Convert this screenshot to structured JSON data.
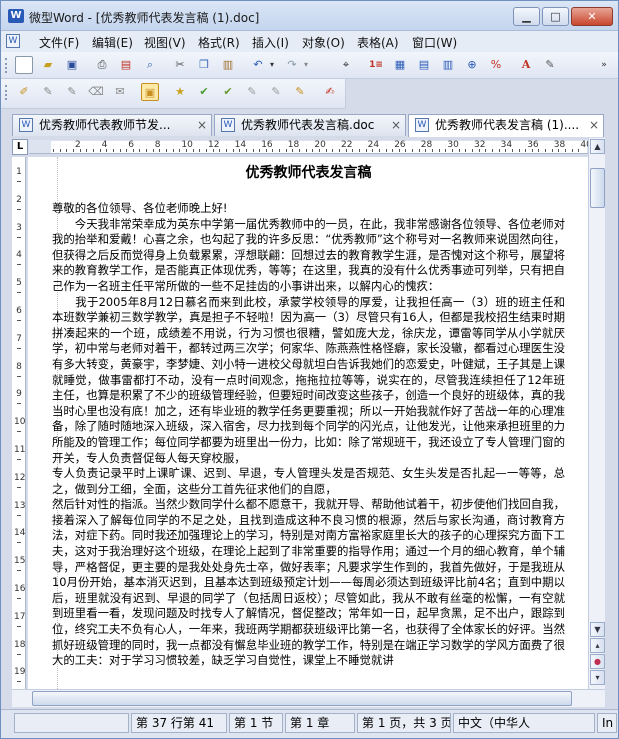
{
  "window": {
    "title": "微型Word - [优秀教师代表发言稿 (1).doc]",
    "app_icon": "W"
  },
  "menu": [
    "文件(F)",
    "编辑(E)",
    "视图(V)",
    "格式(R)",
    "插入(I)",
    "对象(O)",
    "表格(A)",
    "窗口(W)"
  ],
  "tabs": [
    "优秀教师代表教师节发...",
    "优秀教师代表发言稿.doc",
    "优秀教师代表发言稿 (1)...."
  ],
  "ruler_labels": [
    "2",
    "4",
    "6",
    "8",
    "10",
    "12",
    "14",
    "16",
    "18",
    "20",
    "22",
    "24",
    "26",
    "28",
    "30",
    "32",
    "34",
    "36",
    "38",
    "40"
  ],
  "vruler_labels": [
    "1",
    "2",
    "3",
    "4",
    "5",
    "6",
    "7",
    "8",
    "9",
    "10",
    "11",
    "12",
    "13",
    "14",
    "15",
    "16",
    "17",
    "18",
    "19"
  ],
  "document": {
    "title": "优秀教师代表发言稿",
    "paragraphs": [
      "尊敬的各位领导、各位老师晚上好!",
      "　　今天我非常荣幸成为英东中学第一届优秀教师中的一员，在此，我非常感谢各位领导、各位老师对我的抬举和爱戴！心喜之余，也勾起了我的许多反思：“优秀教师”这个称号对一名教师来说固然向往，但获得之后反而觉得身上负载累累，浮想联翩：回想过去的教育教学生涯，是否愧对这个称号，展望将来的教育教学工作，是否能真正体现优秀，等等；在这里，我真的没有什么优秀事迹可列举，只有把自己作为一名班主任平常所做的一些不足挂齿的小事讲出来，以解内心的愧疚：",
      "　　我于2005年8月12日慕名而来到此校，承蒙学校领导的厚爱，让我担任高一（3）班的班主任和本班数学兼初三数学教学，真是担子不轻啦！因为高一（3）尽管只有16人，但都是我校招生结束时期拼凑起来的一个班，成绩差不用说，行为习惯也很糟，譬如庞大龙，徐庆龙，谭雷等同学从小学就厌学，初中常与老师对着干，都转过两三次学；何家华、陈燕燕性格怪癖，家长没辙，都看过心理医生没有多大转变，黄豪宇，李梦婕、刘小特一进校父母就坦白告诉我她们的恋爱史，叶健斌，王子其是上课就睡觉，做事雷都打不动，没有一点时间观念，拖拖拉拉等等，说实在的，尽管我连续担任了12年班主任，也算是积累了不少的班级管理经验，但要短时间改变这些孩子，创造一个良好的班级体，真的我当时心里也没有底！加之，还有毕业班的教学任务更要重视；所以一开始我就作好了苦战一年的心理准备，除了随时随地深入班级，深入宿舍，尽力找到每个同学的闪光点，让他发光，让他来承担班里的力所能及的管理工作；每位同学都要为班里出一份力，比如：除了常规班干，我还设立了专人管理门窗的开关，专人负责督促每人每天穿校服，",
      "专人负责记录平时上课旷课、迟到、早退，专人管理头发是否规范、女生头发是否扎起—一等等，总之，做到分工细，全面，这些分工首先征求他们的自愿，",
      "然后针对性的指派。当然少数同学什么都不愿意干，我就开导、帮助他试着干，初步使他们找回自我，接着深入了解每位同学的不足之处，且找到造成这种不良习惯的根源，然后与家长沟通，商讨教育方法，对症下药。同时我还加强理论上的学习，特别是对南方富裕家庭里长大的孩子的心理探究方面下工夫，这对于我治理好这个班级，在理论上起到了非常重要的指导作用；通过一个月的细心教育，单个辅导，严格督促，更主要的是我处处身先士卒，做好表率；凡要求学生作到的，我首先做好，于是我班从10月份开始，基本消灭迟到，且基本达到班级预定计划——每周必须达到班级评比前4名；直到中期以后，班里就没有迟到、早退的同学了（包括周日返校）；尽管如此，我从不敢有丝毫的松懈，一有空就到班里看一看，发现问题及时找专人了解情况，督促整改；常年如一日，起早贪黑，足不出户，跟踪到位，终究工夫不负有心人，一年来，我班两学期都获班级评比第一名，也获得了全体家长的好评。当然抓好班级管理的同时，我一点都没有懈怠毕业班的教学工作，特别是在端正学习数学的学风方面费了很大的工夫：对于学习习惯较差，缺乏学习自觉性，课堂上不睡觉就讲"
    ]
  },
  "status": {
    "position": "第 37 行第 41",
    "section": "第 1 节",
    "chapter": "第 1 章",
    "pages": "第 1 页，共 3 页",
    "language": "中文（中华人",
    "mode": "In"
  }
}
